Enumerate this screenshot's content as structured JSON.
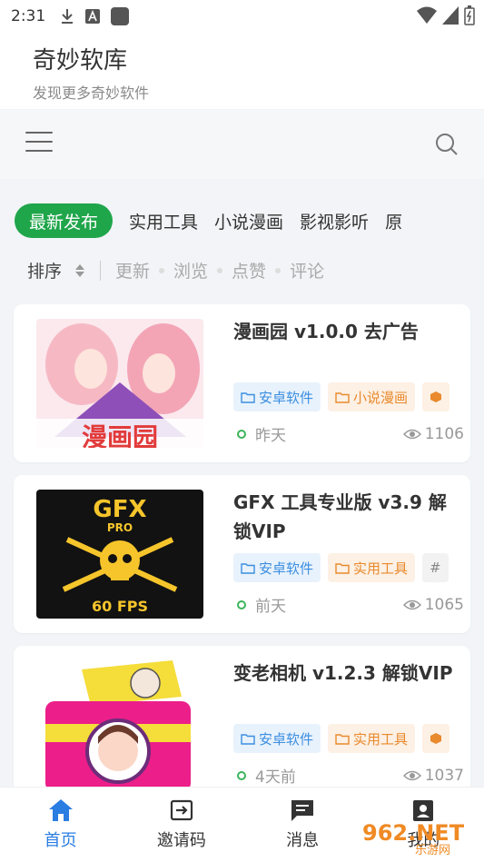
{
  "status": {
    "time": "2:31"
  },
  "app": {
    "title": "奇妙软库",
    "subtitle": "发现更多奇妙软件"
  },
  "categories": [
    "最新发布",
    "实用工具",
    "小说漫画",
    "影视影听",
    "原"
  ],
  "sort": {
    "label": "排序",
    "options": [
      "更新",
      "浏览",
      "点赞",
      "评论"
    ]
  },
  "cards": [
    {
      "title": "漫画园 v1.0.0 去广告",
      "tags": [
        "安卓软件",
        "小说漫画"
      ],
      "time": "昨天",
      "views": "1106",
      "thumb_text": "漫画园"
    },
    {
      "title": "GFX 工具专业版 v3.9 解锁VIP",
      "tags": [
        "安卓软件",
        "实用工具",
        "#"
      ],
      "time": "前天",
      "views": "1065",
      "thumb_text": "GFX",
      "thumb_sub": "PRO",
      "thumb_fps": "60 FPS"
    },
    {
      "title": "变老相机 v1.2.3 解锁VIP",
      "tags": [
        "安卓软件",
        "实用工具"
      ],
      "time": "4天前",
      "views": "1037"
    }
  ],
  "bottom_nav": [
    {
      "label": "首页",
      "icon": "home-icon"
    },
    {
      "label": "邀请码",
      "icon": "invite-icon"
    },
    {
      "label": "消息",
      "icon": "message-icon"
    },
    {
      "label": "我的",
      "icon": "profile-icon"
    }
  ],
  "watermark": {
    "text": "962.NET",
    "sub": "乐游网"
  },
  "colors": {
    "accent_green": "#1fa54a",
    "nav_active": "#2a7de1",
    "tag_blue": "#3b8ee0",
    "tag_orange": "#e88a2d"
  }
}
